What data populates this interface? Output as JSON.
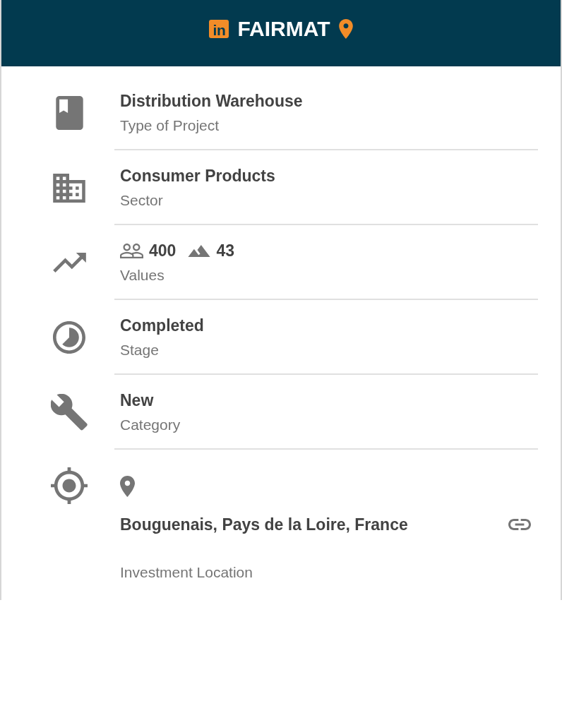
{
  "header": {
    "logo_mark": "in",
    "title": "FAIRMAT"
  },
  "details": [
    {
      "kind": "detail",
      "title": "Distribution Warehouse",
      "label": "Type of Project"
    },
    {
      "kind": "detail",
      "title": "Consumer Products",
      "label": "Sector"
    },
    {
      "kind": "stats",
      "stats": [
        {
          "value": "400"
        },
        {
          "value": "43"
        }
      ],
      "label": "Values"
    },
    {
      "kind": "detail",
      "title": "Completed",
      "label": "Stage"
    },
    {
      "kind": "detail",
      "title": "New",
      "label": "Category"
    },
    {
      "kind": "location",
      "title": "Bouguenais, Pays de la Loire, France",
      "label": "Investment Location"
    }
  ]
}
